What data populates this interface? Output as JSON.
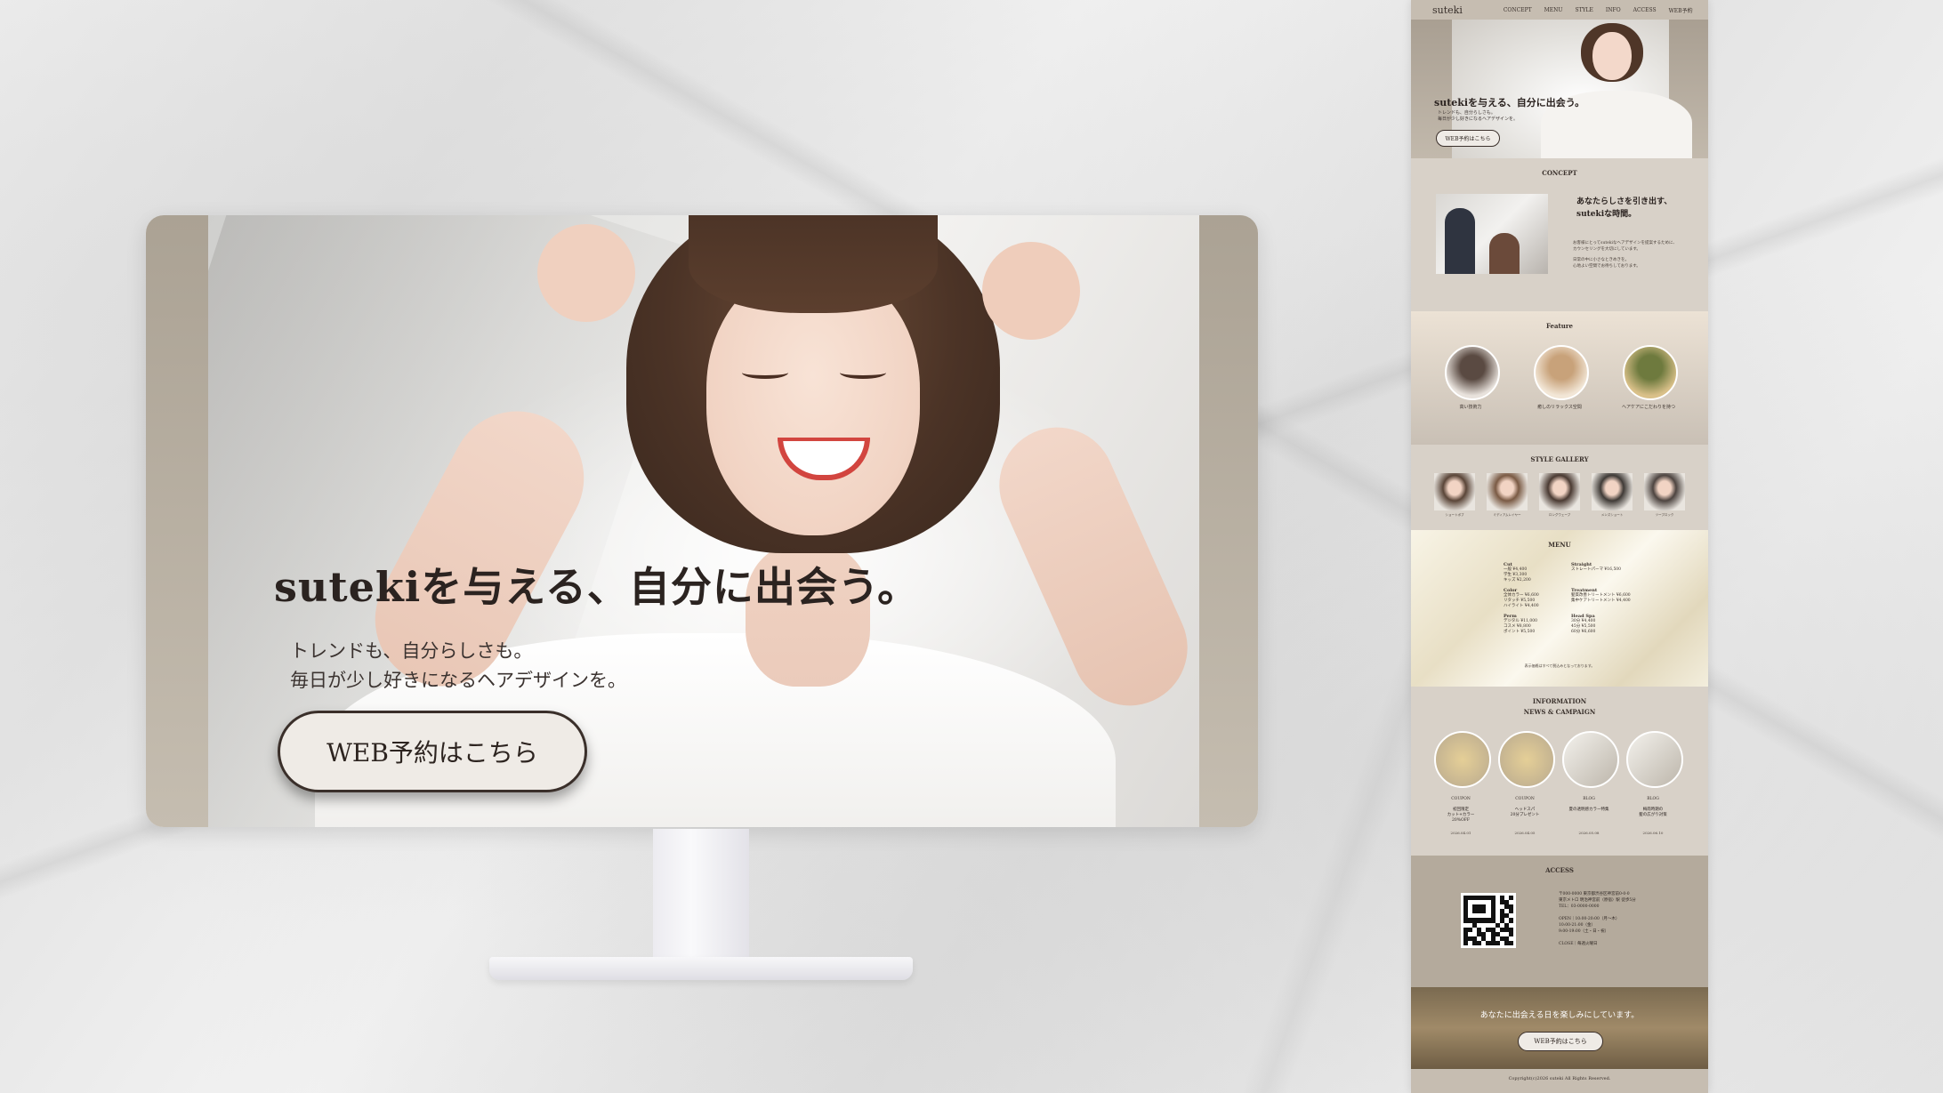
{
  "hero": {
    "headline": "sutekiを与える、自分に出会う。",
    "sub_line1": "トレンドも、自分らしさも。",
    "sub_line2": "毎日が少し好きになるヘアデザインを。",
    "button_label": "WEB予約はこちら"
  },
  "preview": {
    "logo": "suteki",
    "nav": [
      "CONCEPT",
      "MENU",
      "STYLE",
      "INFO",
      "ACCESS",
      "WEB予約"
    ],
    "hero_headline": "sutekiを与える、自分に出会う。",
    "hero_sub1": "トレンドも、自分らしさも。",
    "hero_sub2": "毎日が少し好きになるヘアデザインを。",
    "hero_button": "WEB予約はこちら",
    "concept": {
      "title": "CONCEPT",
      "heading1": "あなたらしさを引き出す、",
      "heading2": "sutekiな時間。",
      "body1": "お客様にとってsutekiなヘアデザインを提案するために、",
      "body2": "カウンセリングを大切にしています。",
      "body3": "日常の中に小さなときめきを。",
      "body4": "心地よい空間でお待ちしております。"
    },
    "feature": {
      "title": "Feature",
      "items": [
        {
          "label": "高い技術力",
          "color1": "#5a4a42",
          "color2": "#e8e2dc"
        },
        {
          "label": "癒しのリラックス空間",
          "color1": "#c8a27a",
          "color2": "#f2e6d6"
        },
        {
          "label": "ヘアケアにこだわりを持つ",
          "color1": "#6e7a3e",
          "color2": "#d9c089"
        }
      ]
    },
    "gallery": {
      "title": "STYLE GALLERY",
      "items": [
        {
          "caption": "ショートボブ",
          "color": "#5a4538"
        },
        {
          "caption": "ミディアムレイヤー",
          "color": "#7a5a44"
        },
        {
          "caption": "ロングウェーブ",
          "color": "#4a3a32"
        },
        {
          "caption": "メンズショート",
          "color": "#3f3a36"
        },
        {
          "caption": "ツーブロック",
          "color": "#4d4440"
        }
      ]
    },
    "menu": {
      "title": "MENU",
      "col1": [
        {
          "cat": "Cut",
          "items": [
            "一般 ¥4,400",
            "学生 ¥3,300",
            "キッズ ¥2,200"
          ]
        },
        {
          "cat": "Color",
          "items": [
            "全体カラー ¥6,600",
            "リタッチ ¥5,500",
            "ハイライト ¥4,400"
          ]
        },
        {
          "cat": "Perm",
          "items": [
            "デジタル ¥11,000",
            "コスメ ¥8,800",
            "ポイント ¥5,500"
          ]
        }
      ],
      "col2": [
        {
          "cat": "Straight",
          "items": [
            "ストレートパーマ ¥16,500"
          ]
        },
        {
          "cat": "Treatment",
          "items": [
            "髪質改善トリートメント ¥6,600",
            "集中ケアトリートメント ¥4,400"
          ]
        },
        {
          "cat": "Head Spa",
          "items": [
            "30分 ¥4,400",
            "45分 ¥5,500",
            "60分 ¥6,600"
          ]
        }
      ],
      "note": "表示価格はすべて税込みとなっております。"
    },
    "info": {
      "title1": "INFORMATION",
      "title2": "NEWS & CAMPAIGN",
      "items": [
        {
          "cat": "COUPON",
          "title1": "初回限定",
          "title2": "カット+カラー",
          "title3": "20%OFF",
          "date": "2026.04.01"
        },
        {
          "cat": "COUPON",
          "title1": "ヘッドスパ",
          "title2": "20分プレゼント",
          "title3": "",
          "date": "2026.04.05"
        },
        {
          "cat": "BLOG",
          "title1": "夏の透明感カラー特集",
          "title2": "",
          "title3": "",
          "date": "2026.05.08"
        },
        {
          "cat": "BLOG",
          "title1": "梅雨時期の",
          "title2": "髪の広がり対策",
          "title3": "",
          "date": "2026.06.10"
        }
      ]
    },
    "access": {
      "title": "ACCESS",
      "lines": [
        "〒000-0000 東京都渋谷区神宮前0-0-0",
        "東京メトロ 明治神宮前〈原宿〉駅 徒歩5分",
        "TEL：03-0000-0000",
        "",
        "OPEN｜10:00-20:00（月〜木）",
        "10:00-21:00（金）",
        "9:00-19:00（土・日・祝）",
        "",
        "CLOSE｜毎週火曜日"
      ]
    },
    "cta": {
      "text": "あなたに出会える日を楽しみにしています。",
      "button": "WEB予約はこちら"
    },
    "copyright": "Copyright(c)2026 suteki All Rights Reserved."
  }
}
